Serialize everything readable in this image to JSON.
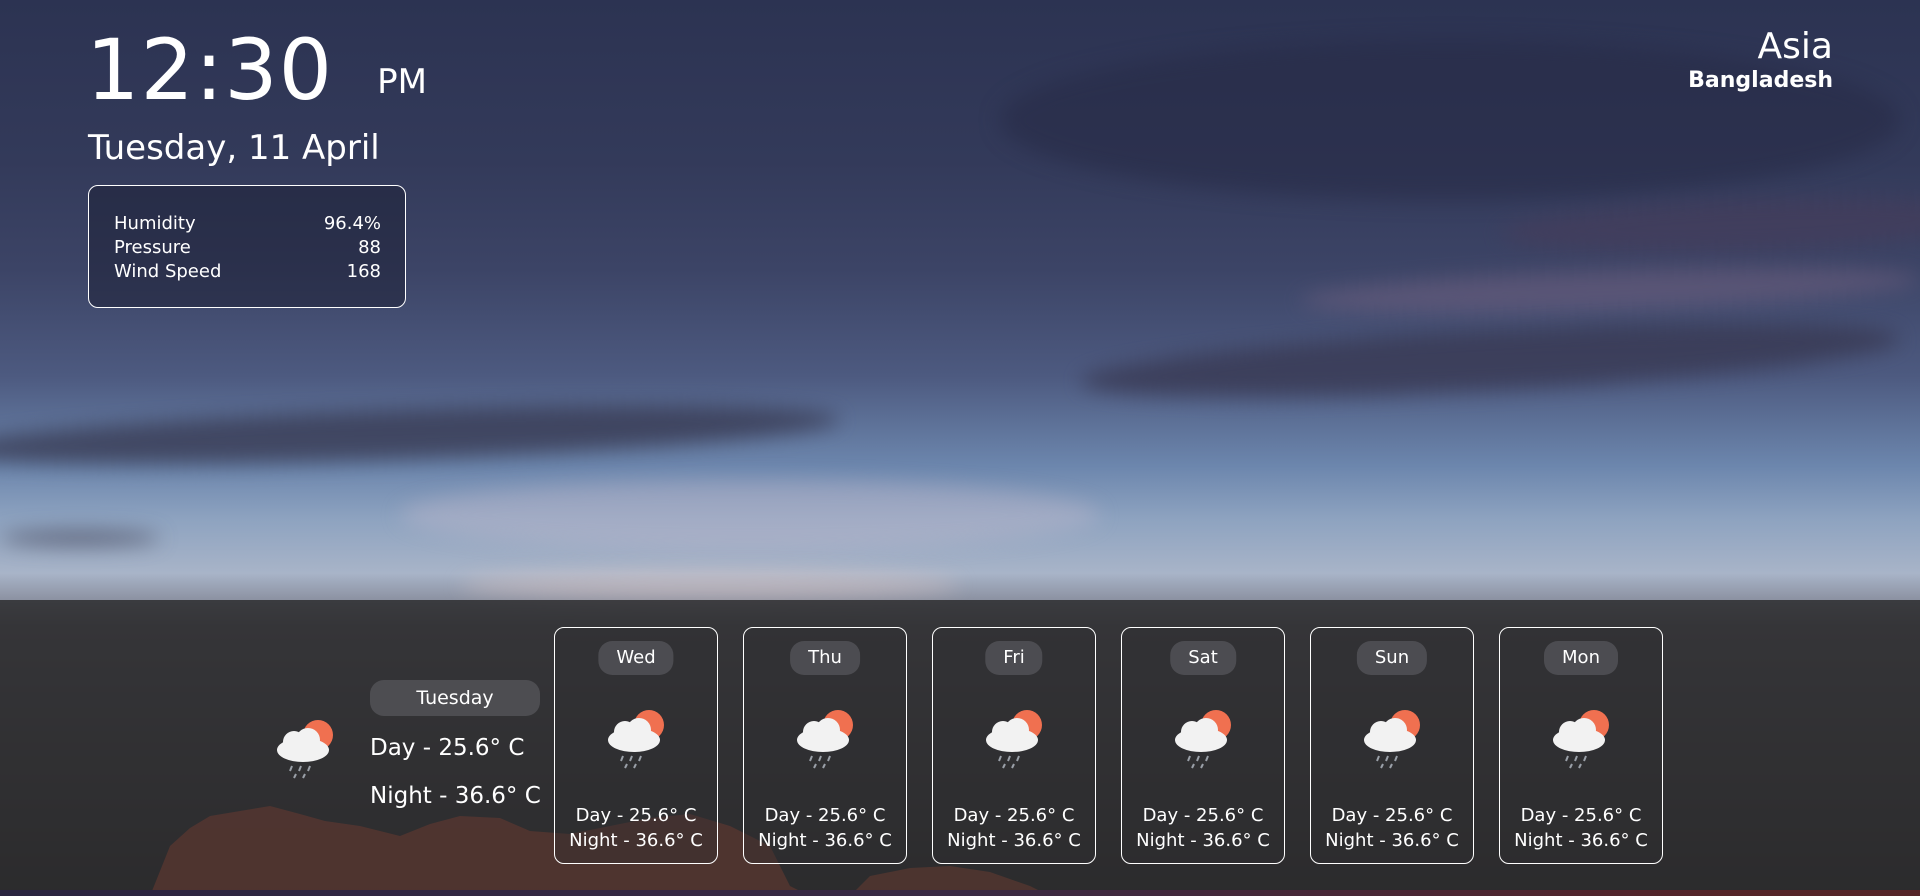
{
  "clock": {
    "time": "12:30",
    "period": "PM",
    "date": "Tuesday, 11 April"
  },
  "stats": [
    {
      "label": "Humidity",
      "value": "96.4%"
    },
    {
      "label": "Pressure",
      "value": "88"
    },
    {
      "label": "Wind Speed",
      "value": "168"
    }
  ],
  "location": {
    "region": "Asia",
    "country": "Bangladesh"
  },
  "today": {
    "day": "Tuesday",
    "day_temp": "Day - 25.6° C",
    "night_temp": "Night - 36.6° C",
    "icon": "cloud-sun-rain-icon"
  },
  "forecast": [
    {
      "day": "Wed",
      "day_temp": "Day - 25.6° C",
      "night_temp": "Night - 36.6° C",
      "icon": "cloud-sun-rain-icon"
    },
    {
      "day": "Thu",
      "day_temp": "Day - 25.6° C",
      "night_temp": "Night - 36.6° C",
      "icon": "cloud-sun-rain-icon"
    },
    {
      "day": "Fri",
      "day_temp": "Day - 25.6° C",
      "night_temp": "Night - 36.6° C",
      "icon": "cloud-sun-rain-icon"
    },
    {
      "day": "Sat",
      "day_temp": "Day - 25.6° C",
      "night_temp": "Night - 36.6° C",
      "icon": "cloud-sun-rain-icon"
    },
    {
      "day": "Sun",
      "day_temp": "Day - 25.6° C",
      "night_temp": "Night - 36.6° C",
      "icon": "cloud-sun-rain-icon"
    },
    {
      "day": "Mon",
      "day_temp": "Day - 25.6° C",
      "night_temp": "Night - 36.6° C",
      "icon": "cloud-sun-rain-icon"
    }
  ],
  "colors": {
    "sun": "#f07050",
    "cloud": "#f2f2f2",
    "rain": "#9aa0a8"
  }
}
